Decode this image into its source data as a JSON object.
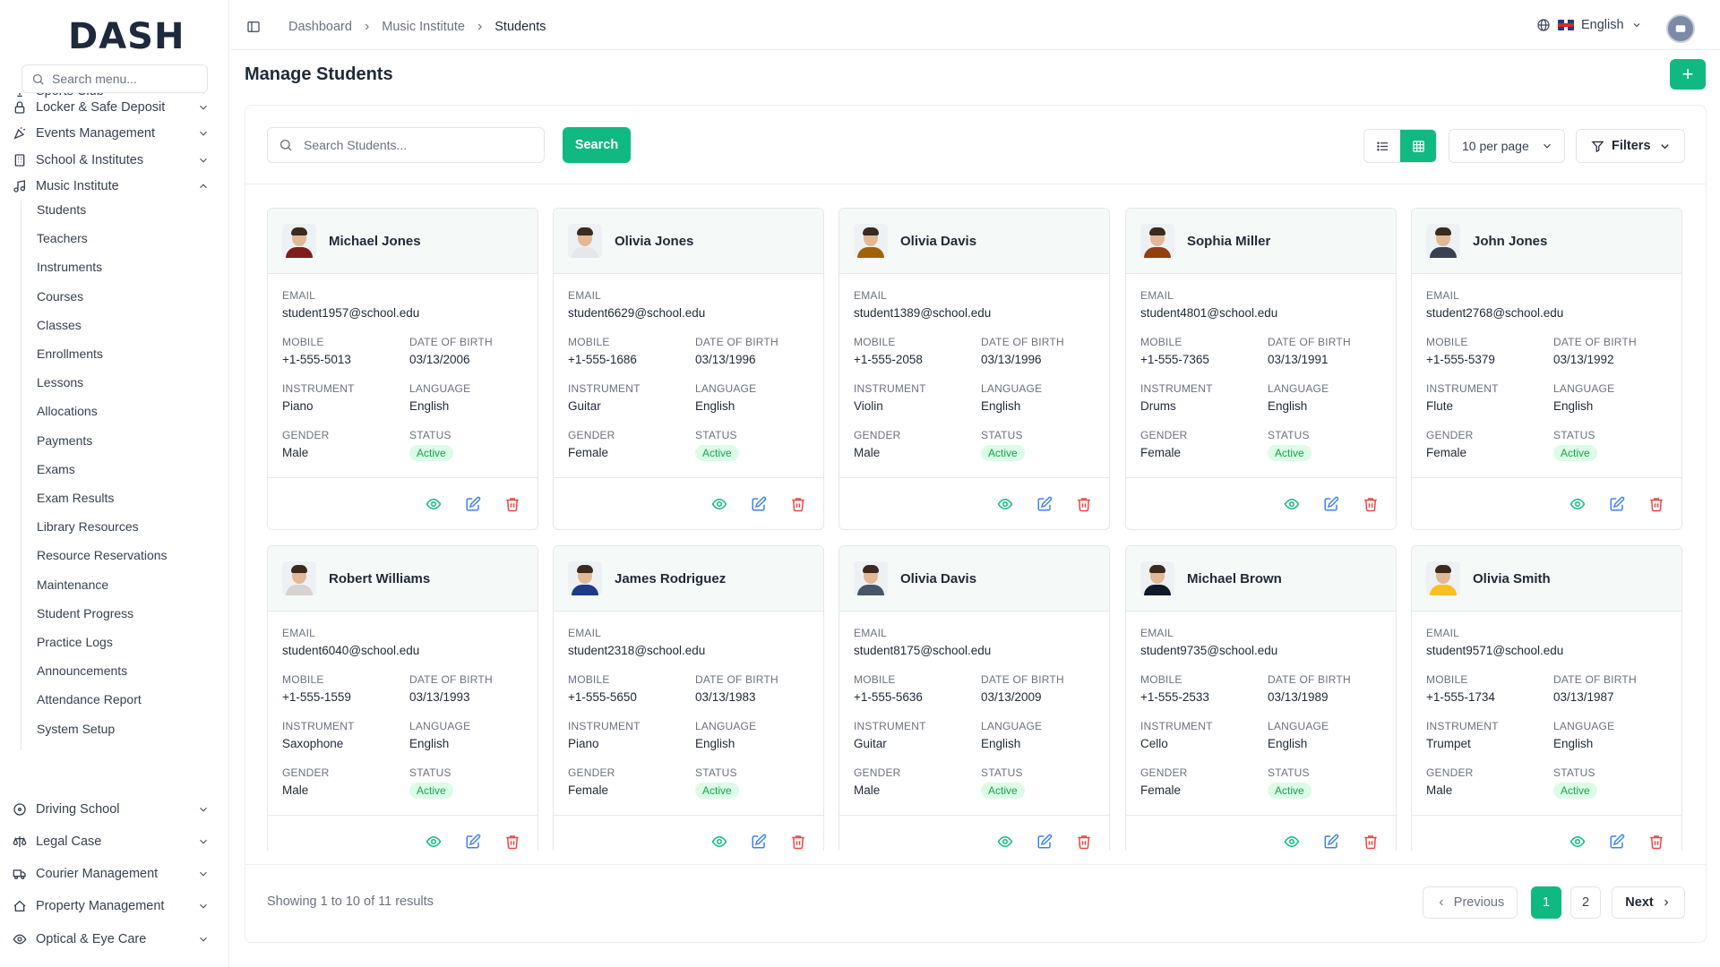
{
  "brand": "DASH",
  "sidebar": {
    "search_placeholder": "Search menu...",
    "top_partial": "Sports Club",
    "items_before": [
      {
        "label": "Locker & Safe Deposit",
        "icon": "lock-icon"
      },
      {
        "label": "Events Management",
        "icon": "party-icon"
      },
      {
        "label": "School & Institutes",
        "icon": "building-icon"
      },
      {
        "label": "Music Institute",
        "icon": "music-note-icon"
      }
    ],
    "sub_items": [
      "Students",
      "Teachers",
      "Instruments",
      "Courses",
      "Classes",
      "Enrollments",
      "Lessons",
      "Allocations",
      "Payments",
      "Exams",
      "Exam Results",
      "Library Resources",
      "Resource Reservations",
      "Maintenance",
      "Student Progress",
      "Practice Logs",
      "Announcements",
      "Attendance Report",
      "System Setup"
    ],
    "items_after": [
      {
        "label": "Driving School",
        "icon": "steering-icon"
      },
      {
        "label": "Legal Case",
        "icon": "scale-icon"
      },
      {
        "label": "Courier Management",
        "icon": "truck-icon"
      },
      {
        "label": "Property Management",
        "icon": "property-icon"
      },
      {
        "label": "Optical & Eye Care",
        "icon": "eye-icon"
      }
    ]
  },
  "header": {
    "breadcrumb": [
      "Dashboard",
      "Music Institute",
      "Students"
    ],
    "language": "English"
  },
  "page": {
    "title": "Manage Students",
    "add_label": "+",
    "search_placeholder": "Search Students...",
    "search_button": "Search",
    "per_page": "10 per page",
    "filters": "Filters"
  },
  "labels": {
    "email": "EMAIL",
    "mobile": "MOBILE",
    "dob": "DATE OF BIRTH",
    "instrument": "INSTRUMENT",
    "language": "LANGUAGE",
    "gender": "GENDER",
    "status": "STATUS"
  },
  "students": [
    {
      "name": "Michael Jones",
      "email": "student1957@school.edu",
      "mobile": "+1-555-5013",
      "dob": "03/13/2006",
      "instrument": "Piano",
      "language": "English",
      "gender": "Male",
      "status": "Active",
      "shirt": "#7f1d1d"
    },
    {
      "name": "Olivia Jones",
      "email": "student6629@school.edu",
      "mobile": "+1-555-1686",
      "dob": "03/13/1996",
      "instrument": "Guitar",
      "language": "English",
      "gender": "Female",
      "status": "Active",
      "shirt": "#e5e7eb"
    },
    {
      "name": "Olivia Davis",
      "email": "student1389@school.edu",
      "mobile": "+1-555-2058",
      "dob": "03/13/1996",
      "instrument": "Violin",
      "language": "English",
      "gender": "Male",
      "status": "Active",
      "shirt": "#a16207"
    },
    {
      "name": "Sophia Miller",
      "email": "student4801@school.edu",
      "mobile": "+1-555-7365",
      "dob": "03/13/1991",
      "instrument": "Drums",
      "language": "English",
      "gender": "Female",
      "status": "Active",
      "shirt": "#92400e"
    },
    {
      "name": "John Jones",
      "email": "student2768@school.edu",
      "mobile": "+1-555-5379",
      "dob": "03/13/1992",
      "instrument": "Flute",
      "language": "English",
      "gender": "Female",
      "status": "Active",
      "shirt": "#374151"
    },
    {
      "name": "Robert Williams",
      "email": "student6040@school.edu",
      "mobile": "+1-555-1559",
      "dob": "03/13/1993",
      "instrument": "Saxophone",
      "language": "English",
      "gender": "Male",
      "status": "Active",
      "shirt": "#d6d3d1"
    },
    {
      "name": "James Rodriguez",
      "email": "student2318@school.edu",
      "mobile": "+1-555-5650",
      "dob": "03/13/1983",
      "instrument": "Piano",
      "language": "English",
      "gender": "Female",
      "status": "Active",
      "shirt": "#1e3a8a"
    },
    {
      "name": "Olivia Davis",
      "email": "student8175@school.edu",
      "mobile": "+1-555-5636",
      "dob": "03/13/2009",
      "instrument": "Guitar",
      "language": "English",
      "gender": "Male",
      "status": "Active",
      "shirt": "#475569"
    },
    {
      "name": "Michael Brown",
      "email": "student9735@school.edu",
      "mobile": "+1-555-2533",
      "dob": "03/13/1989",
      "instrument": "Cello",
      "language": "English",
      "gender": "Female",
      "status": "Active",
      "shirt": "#111827"
    },
    {
      "name": "Olivia Smith",
      "email": "student9571@school.edu",
      "mobile": "+1-555-1734",
      "dob": "03/13/1987",
      "instrument": "Trumpet",
      "language": "English",
      "gender": "Male",
      "status": "Active",
      "shirt": "#fbbf24"
    }
  ],
  "pagination": {
    "showing": "Showing 1 to 10 of 11 results",
    "previous": "Previous",
    "pages": [
      "1",
      "2"
    ],
    "next": "Next"
  },
  "colors": {
    "accent": "#10b981",
    "edit": "#3b82f6",
    "delete": "#ef4444"
  }
}
